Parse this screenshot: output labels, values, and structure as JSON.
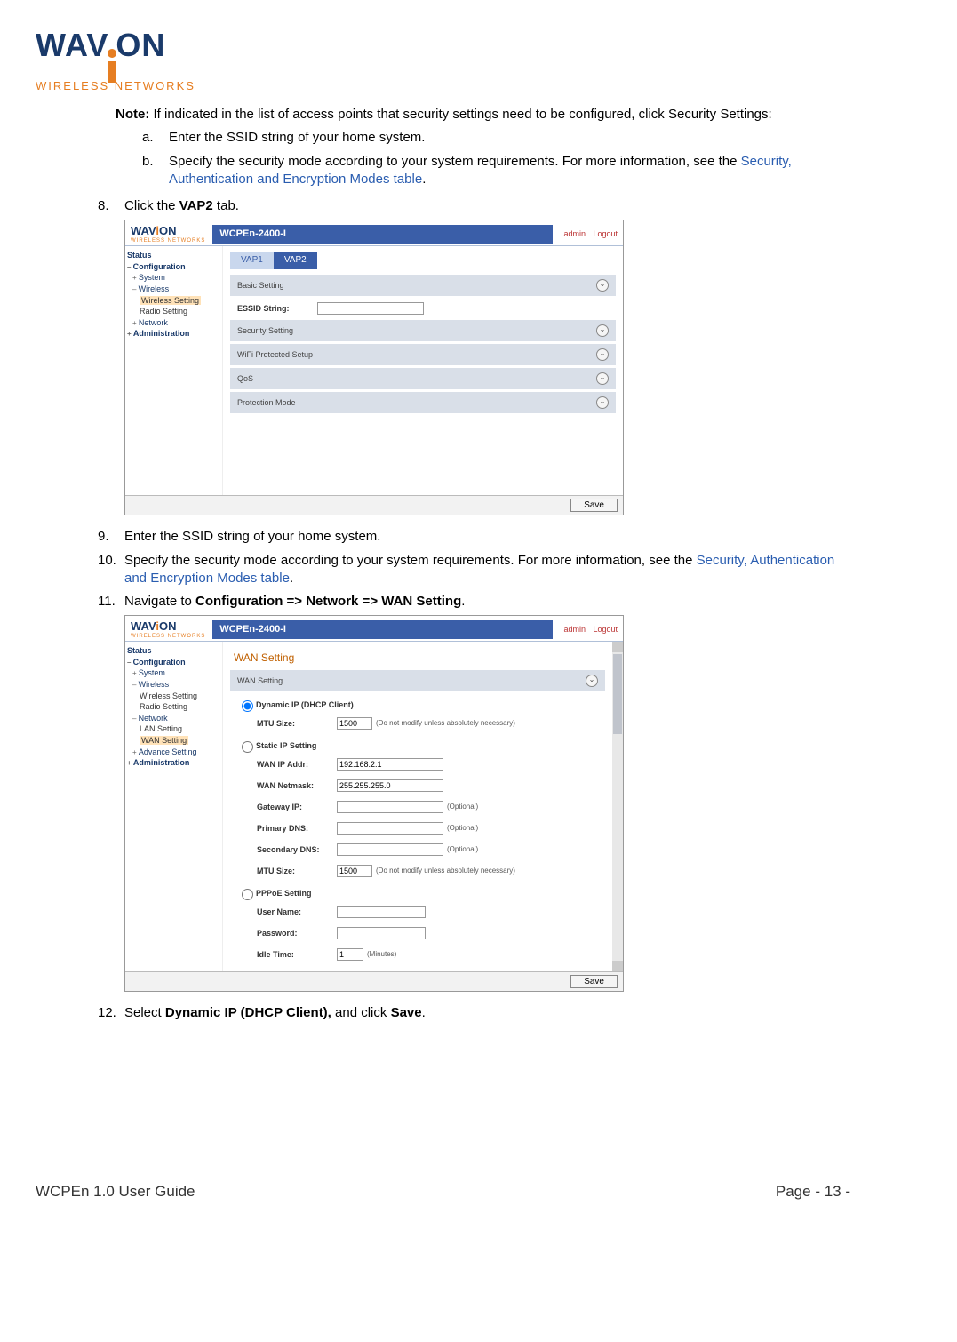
{
  "logo": {
    "brand_left": "WAV",
    "brand_right": "ON",
    "subtitle": "WIRELESS NETWORKS"
  },
  "note": {
    "label": "Note:",
    "text": " If indicated in the list of access points that security settings need to be configured, click Security Settings:",
    "a": "Enter the SSID string of your home system.",
    "b_pre": "Specify the security mode according to your system requirements. For more information, see the ",
    "b_link": "Security, Authentication and Encryption Modes table",
    "b_post": "."
  },
  "steps": {
    "s8_pre": "Click the ",
    "s8_bold": "VAP2",
    "s8_post": " tab.",
    "s9": "Enter the SSID string of your home system.",
    "s10_pre": "Specify the security mode according to your system requirements. For more information, see the ",
    "s10_link": "Security, Authentication and Encryption Modes table",
    "s10_post": ".",
    "s11_pre": "Navigate to ",
    "s11_bold": "Configuration => Network => WAN Setting",
    "s11_post": ".",
    "s12_pre": "Select ",
    "s12_bold1": "Dynamic IP (DHCP Client),",
    "s12_mid": " and click ",
    "s12_bold2": "Save",
    "s12_post": "."
  },
  "ui1": {
    "product": "WCPEn-2400-I",
    "links": {
      "admin": "admin",
      "logout": "Logout"
    },
    "side": {
      "status": "Status",
      "configuration": "Configuration",
      "system": "System",
      "wireless": "Wireless",
      "wireless_setting": "Wireless Setting",
      "radio_setting": "Radio Setting",
      "network": "Network",
      "administration": "Administration"
    },
    "tabs": {
      "vap1": "VAP1",
      "vap2": "VAP2"
    },
    "panels": {
      "basic": "Basic Setting",
      "essid_label": "ESSID String:",
      "security": "Security Setting",
      "wps": "WiFi Protected Setup",
      "qos": "QoS",
      "protection": "Protection Mode"
    },
    "save": "Save"
  },
  "ui2": {
    "product": "WCPEn-2400-I",
    "links": {
      "admin": "admin",
      "logout": "Logout"
    },
    "side": {
      "status": "Status",
      "configuration": "Configuration",
      "system": "System",
      "wireless": "Wireless",
      "wireless_setting": "Wireless Setting",
      "radio_setting": "Radio Setting",
      "network": "Network",
      "lan_setting": "LAN Setting",
      "wan_setting": "WAN Setting",
      "advance_setting": "Advance Setting",
      "administration": "Administration"
    },
    "title": "WAN Setting",
    "panel": "WAN Setting",
    "dhcp": "Dynamic IP (DHCP Client)",
    "mtu_label": "MTU Size:",
    "mtu_val": "1500",
    "mtu_hint": "(Do not modify unless absolutely necessary)",
    "static": "Static IP Setting",
    "wan_ip_label": "WAN IP Addr:",
    "wan_ip_val": "192.168.2.1",
    "wan_nm_label": "WAN Netmask:",
    "wan_nm_val": "255.255.255.0",
    "gw_label": "Gateway IP:",
    "pdns_label": "Primary DNS:",
    "sdns_label": "Secondary DNS:",
    "optional": "(Optional)",
    "pppoe": "PPPoE Setting",
    "user_label": "User Name:",
    "pass_label": "Password:",
    "idle_label": "Idle Time:",
    "idle_val": "1",
    "idle_unit": "(Minutes)",
    "save": "Save"
  },
  "footer": {
    "left": "WCPEn 1.0 User Guide",
    "right": "Page - 13 -"
  }
}
